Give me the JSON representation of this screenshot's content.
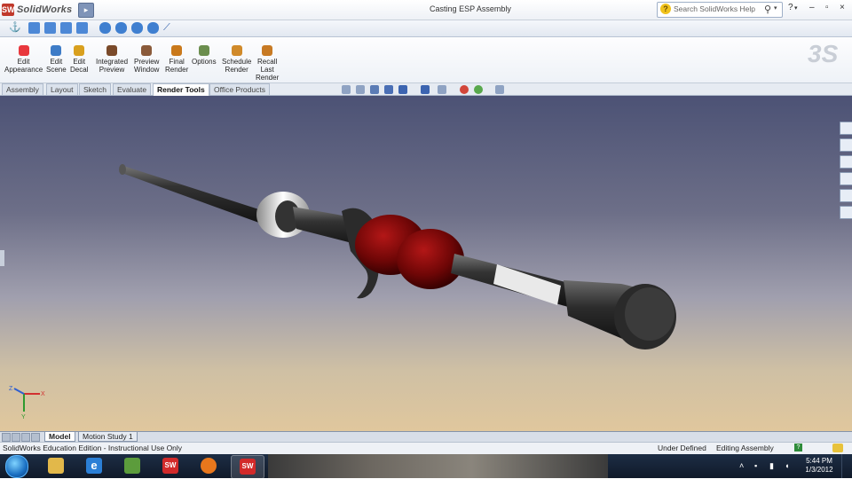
{
  "titlebar": {
    "app_name": "SolidWorks",
    "logo_letters": "SW",
    "document_title": "Casting ESP Assembly",
    "search_placeholder": "Search SolidWorks Help",
    "help_label": "?",
    "minimize": "–",
    "close": "×"
  },
  "command_manager": [
    {
      "label": "Edit\nAppearance",
      "icon": "edit-appearance-icon",
      "color": "#e8383d"
    },
    {
      "label": "Edit\nScene",
      "icon": "edit-scene-icon",
      "color": "#3e7cc7"
    },
    {
      "label": "Edit\nDecal",
      "icon": "edit-decal-icon",
      "color": "#d9a01e"
    },
    {
      "label": "Integrated\nPreview",
      "icon": "integrated-preview-icon",
      "color": "#7a4a2a"
    },
    {
      "label": "Preview\nWindow",
      "icon": "preview-window-icon",
      "color": "#8a5a3a"
    },
    {
      "label": "Final\nRender",
      "icon": "final-render-icon",
      "color": "#c9791b"
    },
    {
      "label": "Options",
      "icon": "options-icon",
      "color": "#6b8e4e"
    },
    {
      "label": "Schedule\nRender",
      "icon": "schedule-render-icon",
      "color": "#d08a2a"
    },
    {
      "label": "Recall\nLast\nRender",
      "icon": "recall-last-render-icon",
      "color": "#c77a24"
    }
  ],
  "tabs": [
    {
      "label": "Assembly",
      "active": false
    },
    {
      "label": "Layout",
      "active": false
    },
    {
      "label": "Sketch",
      "active": false
    },
    {
      "label": "Evaluate",
      "active": false
    },
    {
      "label": "Render Tools",
      "active": true
    },
    {
      "label": "Office Products",
      "active": false
    }
  ],
  "bottom_tabs": [
    {
      "label": "Model",
      "active": true
    },
    {
      "label": "Motion Study 1",
      "active": false
    }
  ],
  "statusbar": {
    "left": "SolidWorks Education Edition - Instructional Use Only",
    "state": "Under Defined",
    "mode": "Editing Assembly",
    "help": "?"
  },
  "triad": {
    "x": "X",
    "y": "Y",
    "z": "Z"
  },
  "taskbar": {
    "time": "5:44 PM",
    "date": "1/3/2012",
    "apps": [
      {
        "name": "explorer",
        "label": ""
      },
      {
        "name": "internet-explorer",
        "label": "e"
      },
      {
        "name": "network",
        "label": ""
      },
      {
        "name": "solidworks-1",
        "label": "SW"
      },
      {
        "name": "firefox",
        "label": ""
      },
      {
        "name": "solidworks-2",
        "label": "SW"
      }
    ]
  },
  "colors": {
    "rod": "#2b2b2b",
    "reel_red": "#7a0a0a",
    "ring": "#d8d8d8"
  }
}
